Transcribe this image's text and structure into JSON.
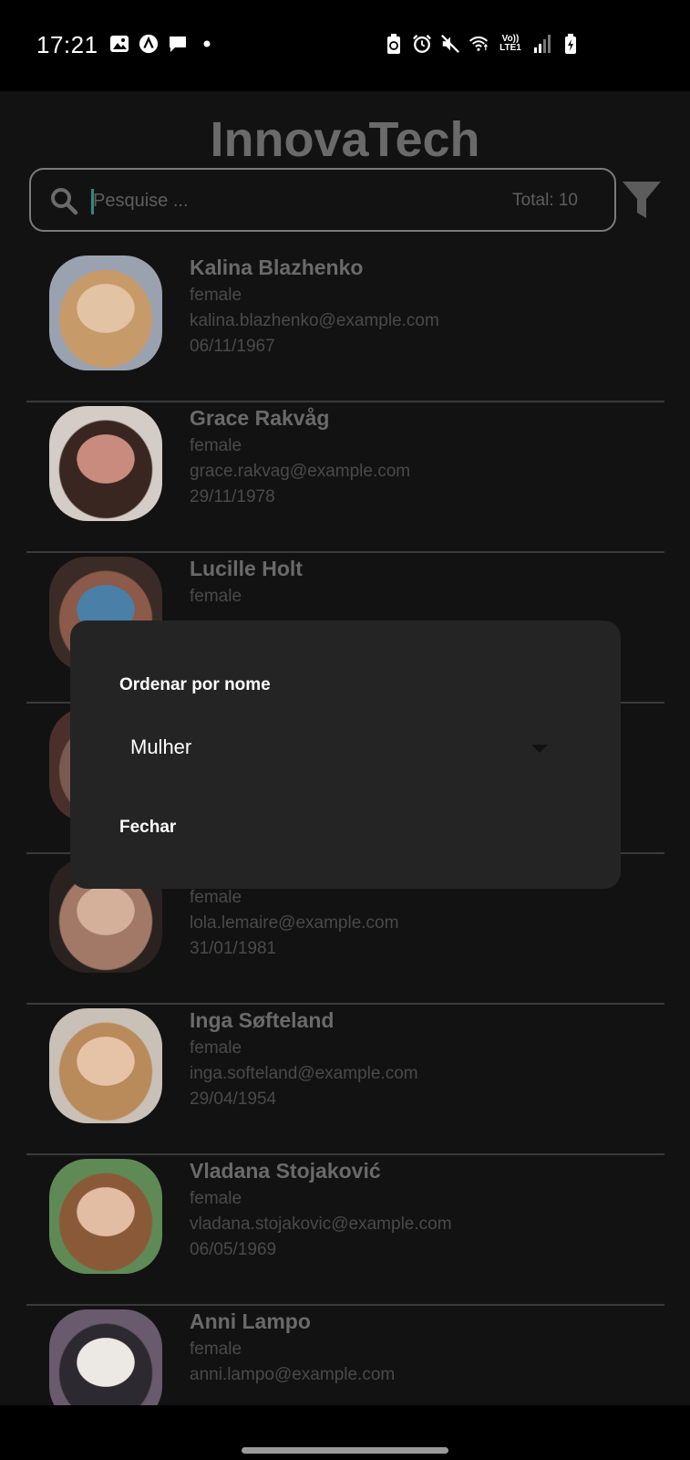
{
  "status_bar": {
    "time": "17:21",
    "left_icons": [
      "image-icon",
      "app-icon",
      "chat-icon",
      "dot-icon"
    ],
    "right_icons": [
      "battery-saver-icon",
      "alarm-icon",
      "mute-icon",
      "wifi-icon",
      "volte-icon",
      "signal-icon",
      "battery-icon"
    ],
    "volte_label": "Vo)) LTE1"
  },
  "app": {
    "title": "InnovaTech",
    "search": {
      "placeholder": "Pesquise ...",
      "value": ""
    },
    "total_label": "Total: 10"
  },
  "users": [
    {
      "name": "Kalina Blazhenko",
      "gender": "female",
      "email": "kalina.blazhenko@example.com",
      "dob": "06/11/1967",
      "photo_colors": [
        "#9aa2b0",
        "#c79a6a",
        "#e2c3a3"
      ]
    },
    {
      "name": "Grace Rakvåg",
      "gender": "female",
      "email": "grace.rakvag@example.com",
      "dob": "29/11/1978",
      "photo_colors": [
        "#d4ccc7",
        "#3a2620",
        "#c98b7e"
      ]
    },
    {
      "name": "Lucille Holt",
      "gender": "female",
      "email": "",
      "dob": "",
      "photo_colors": [
        "#3b2b27",
        "#8b5a4a",
        "#4a7fa7"
      ]
    },
    {
      "name": "",
      "gender": "",
      "email": "",
      "dob": "",
      "photo_colors": [
        "#4a2f2a",
        "#7a5a50",
        "#6f4a40"
      ]
    },
    {
      "name": "",
      "gender": "female",
      "email": "lola.lemaire@example.com",
      "dob": "31/01/1981",
      "photo_colors": [
        "#2a2220",
        "#a27866",
        "#d4b09a"
      ]
    },
    {
      "name": "Inga Søfteland",
      "gender": "female",
      "email": "inga.softeland@example.com",
      "dob": "29/04/1954",
      "photo_colors": [
        "#c9c0b8",
        "#b98a5a",
        "#e6c3a6"
      ]
    },
    {
      "name": "Vladana Stojaković",
      "gender": "female",
      "email": "vladana.stojakovic@example.com",
      "dob": "06/05/1969",
      "photo_colors": [
        "#5f8a56",
        "#8a5a38",
        "#e2bca3"
      ]
    },
    {
      "name": "Anni Lampo",
      "gender": "female",
      "email": "anni.lampo@example.com",
      "dob": "",
      "photo_colors": [
        "#6a5a6e",
        "#2c2a30",
        "#ece8e4"
      ]
    }
  ],
  "dialog": {
    "title": "Ordenar por nome",
    "dropdown_value": "Mulher",
    "close_label": "Fechar"
  }
}
